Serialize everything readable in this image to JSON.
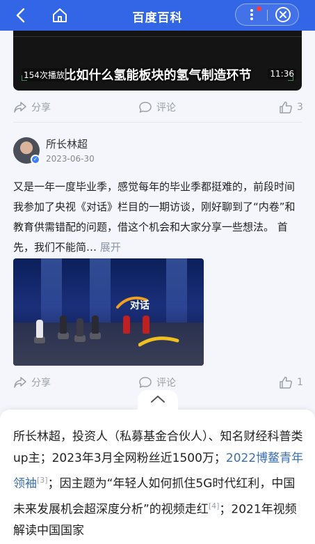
{
  "header": {
    "title": "百度百科",
    "back_icon": "back-arrow-icon",
    "home_icon": "home-icon",
    "more_icon": "more-vertical-icon",
    "close_icon": "close-circle-icon",
    "bg_color": "#3366e6"
  },
  "video1": {
    "caption": "比如什么氢能板块的氢气制造环节",
    "plays": "154次播放",
    "duration": "11:36"
  },
  "actions1": {
    "share": "分享",
    "comment": "评论",
    "likes": "3"
  },
  "post": {
    "author": "所长林超",
    "date": "2023-06-30",
    "text": "又是一年一度毕业季，感觉每年的毕业季都挺难的，前段时间我参加了央视《对话》栏目的一期访谈，刚好聊到了“内卷”和教育供需错配的问题，借这个机会和大家分享一些想法。 首先，我们不能简…",
    "expand": "展开",
    "video_logo_text": "对话"
  },
  "actions2": {
    "share": "分享",
    "comment": "评论",
    "likes": "1"
  },
  "bio": {
    "part1": "所长林超，投资人（私募基金合伙人）、知名财经科普类up主；2023年3月全网粉丝近1500万；",
    "link": "2022博鳌青年领袖",
    "ref1": "[3]",
    "part2": "；因主题为“年轻人如何抓住5G时代红利，中国未来发展机会超深度分析”的视频走红",
    "ref2": "[4]",
    "part3": "；2021年视频解读中国国家"
  }
}
